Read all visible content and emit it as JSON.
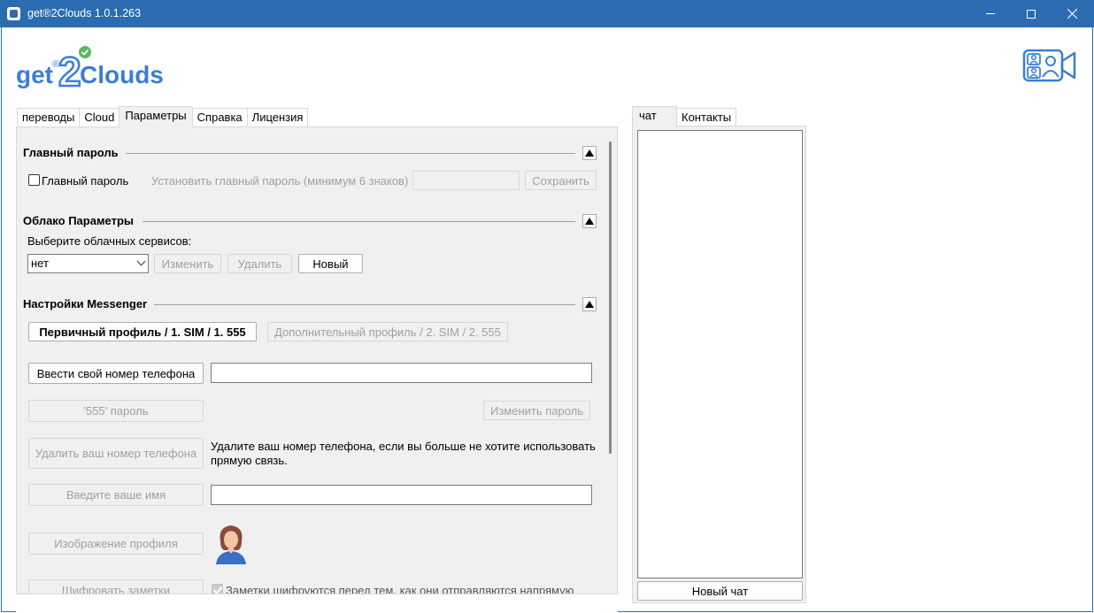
{
  "window": {
    "title": "get®2Clouds 1.0.1.263"
  },
  "logo": {
    "text_get": "get",
    "text_2": "2",
    "text_clouds": "Clouds",
    "registered": "®"
  },
  "tabs": [
    "переводы",
    "Cloud",
    "Параметры",
    "Справка",
    "Лицензия"
  ],
  "active_tab": "Параметры",
  "master_password": {
    "title": "Главный пароль",
    "checkbox_label": "Главный пароль",
    "set_label": "Установить главный пароль (минимум 6 знаков)",
    "save_button": "Сохранить"
  },
  "cloud_params": {
    "title": "Облако Параметры",
    "select_label": "Выберите облачных сервисов:",
    "select_value": "нет",
    "edit_button": "Изменить",
    "delete_button": "Удалить",
    "new_button": "Новый"
  },
  "messenger": {
    "title": "Настройки Messenger",
    "primary_profile_button": "Первичный профиль / 1. SIM / 1. 555",
    "secondary_profile_button": "Дополнительный профиль / 2. SIM / 2. 555",
    "enter_phone_button": "Ввести свой номер телефона",
    "phone_value": "",
    "password_555_button": "'555' пароль",
    "change_password_button": "Изменить пароль",
    "delete_phone_button": "Удалить ваш номер телефона",
    "delete_phone_note": "Удалите ваш номер телефона, если вы больше не хотите использовать прямую связь.",
    "enter_name_button": "Введите ваше имя",
    "name_value": "",
    "profile_image_button": "Изображение профиля",
    "encrypt_notes_button": "Шифровать заметки",
    "encrypt_notes_checkbox": "Заметки шифруются перед тем, как они отправляются напрямую"
  },
  "chat": {
    "tabs": [
      "чат",
      "Контакты"
    ],
    "active_tab": "чат",
    "new_chat_button": "Новый чат"
  },
  "colors": {
    "titlebar": "#2b6cb0",
    "logo_blue": "#3b7dd8",
    "check_green": "#5cb85c"
  }
}
